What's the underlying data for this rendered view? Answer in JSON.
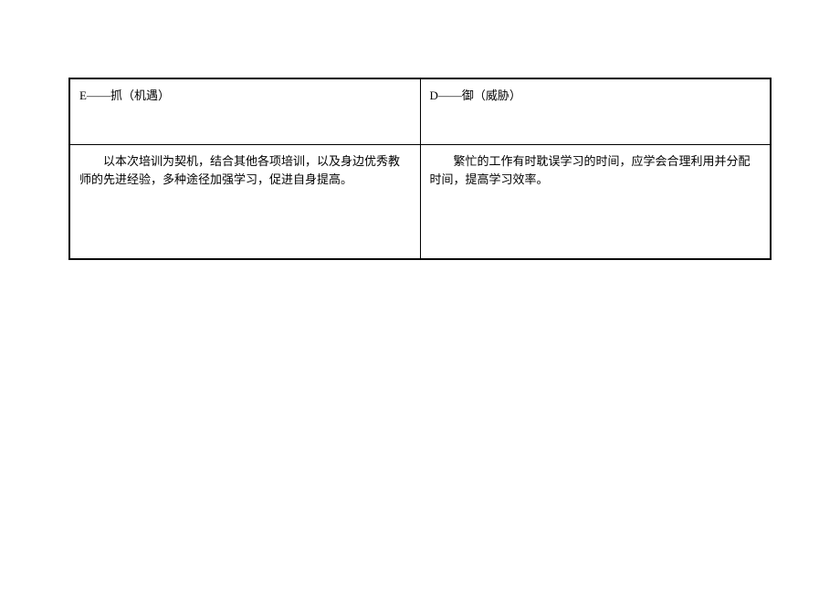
{
  "table": {
    "headers": {
      "left": "E——抓（机遇）",
      "right": "D——御（威胁）"
    },
    "cells": {
      "left": "以本次培训为契机，结合其他各项培训，以及身边优秀教师的先进经验，多种途径加强学习，促进自身提高。",
      "right": "繁忙的工作有时耽误学习的时间，应学会合理利用并分配时间，提高学习效率。"
    }
  }
}
